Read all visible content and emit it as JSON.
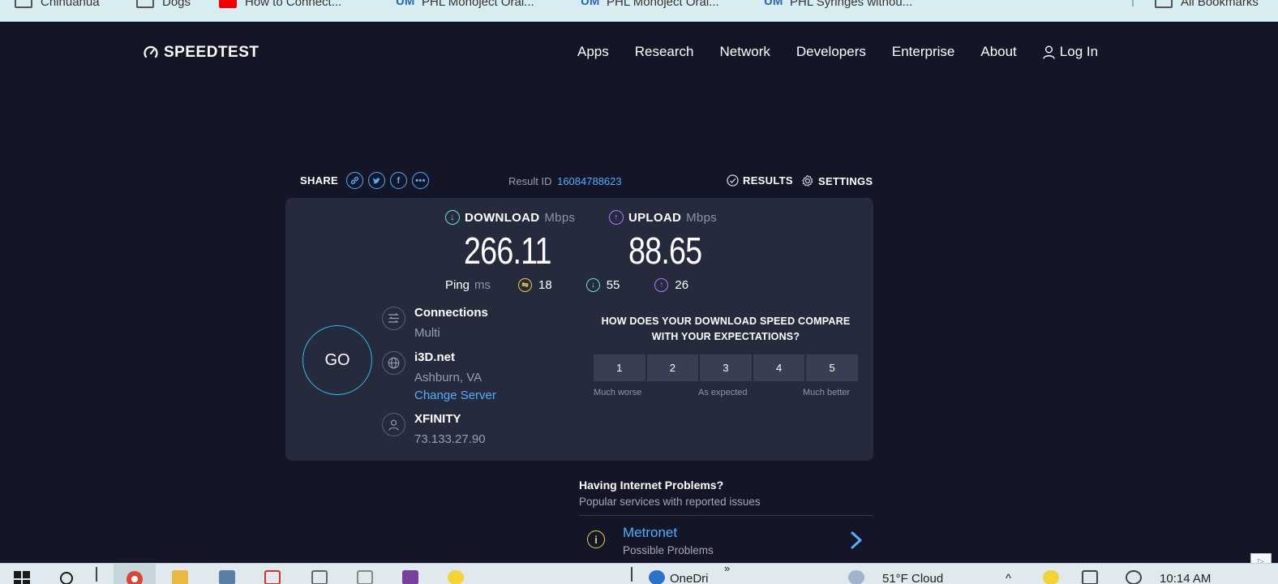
{
  "bookmarks": [
    {
      "label": "Chihuahua",
      "icon": "folder-icon"
    },
    {
      "label": "Dogs",
      "icon": "folder-icon"
    },
    {
      "label": "How to Connect...",
      "icon": "youtube-icon"
    },
    {
      "label": "PHL Monoject Oral...",
      "icon": "um-icon"
    },
    {
      "label": "PHL Monoject Oral...",
      "icon": "um-icon"
    },
    {
      "label": "PHL Syringes withou...",
      "icon": "um-icon"
    },
    {
      "label": "All Bookmarks",
      "icon": "folder-icon"
    }
  ],
  "header": {
    "logo": "SPEEDTEST",
    "nav": [
      "Apps",
      "Research",
      "Network",
      "Developers",
      "Enterprise",
      "About"
    ],
    "login": "Log In"
  },
  "toolbar": {
    "share_label": "SHARE",
    "result_id_label": "Result ID",
    "result_id": "16084788623",
    "results_label": "RESULTS",
    "settings_label": "SETTINGS"
  },
  "download": {
    "label": "DOWNLOAD",
    "unit": "Mbps",
    "value": "266.11",
    "color": "#69e3d9"
  },
  "upload": {
    "label": "UPLOAD",
    "unit": "Mbps",
    "value": "88.65",
    "color": "#b477ff"
  },
  "ping": {
    "label": "Ping",
    "unit": "ms",
    "idle": "18",
    "download": "55",
    "upload": "26"
  },
  "go_label": "GO",
  "connections": {
    "title": "Connections",
    "value": "Multi"
  },
  "server": {
    "name": "i3D.net",
    "location": "Ashburn, VA",
    "change": "Change Server"
  },
  "isp": {
    "name": "XFINITY",
    "ip": "73.133.27.90"
  },
  "survey": {
    "question": "HOW DOES YOUR DOWNLOAD SPEED COMPARE WITH YOUR EXPECTATIONS?",
    "options": [
      "1",
      "2",
      "3",
      "4",
      "5"
    ],
    "low": "Much worse",
    "mid": "As expected",
    "high": "Much better"
  },
  "problems": {
    "title": "Having Internet Problems?",
    "subtitle": "Popular services with reported issues",
    "items": [
      {
        "name": "Metronet",
        "status": "Possible Problems"
      }
    ]
  },
  "taskbar": {
    "onedrive": "OneDri",
    "weather": "51°F Cloud",
    "time": "10:14 AM"
  }
}
